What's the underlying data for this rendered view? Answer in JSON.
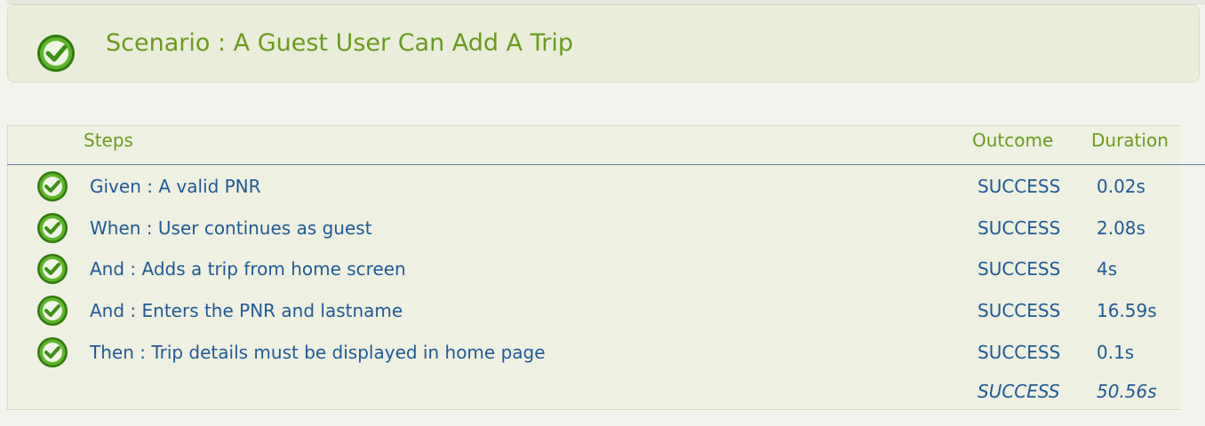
{
  "scenario": {
    "title": "Scenario : A Guest User Can Add A Trip",
    "status_icon": "success-check-icon"
  },
  "table": {
    "headers": {
      "steps": "Steps",
      "outcome": "Outcome",
      "duration": "Duration"
    },
    "rows": [
      {
        "step": "Given : A valid PNR",
        "outcome": "SUCCESS",
        "duration": "0.02s"
      },
      {
        "step": "When : User continues as guest",
        "outcome": "SUCCESS",
        "duration": "2.08s"
      },
      {
        "step": "And : Adds a trip from home screen",
        "outcome": "SUCCESS",
        "duration": "4s"
      },
      {
        "step": "And : Enters the PNR and lastname",
        "outcome": "SUCCESS",
        "duration": "16.59s"
      },
      {
        "step": "Then : Trip details must be displayed in home page",
        "outcome": "SUCCESS",
        "duration": "0.1s"
      }
    ],
    "summary": {
      "outcome": "SUCCESS",
      "duration": "50.56s"
    }
  },
  "colors": {
    "accent_green": "#6b9a1e",
    "text_blue": "#1f5a96",
    "check_green": "#4c9b17"
  }
}
